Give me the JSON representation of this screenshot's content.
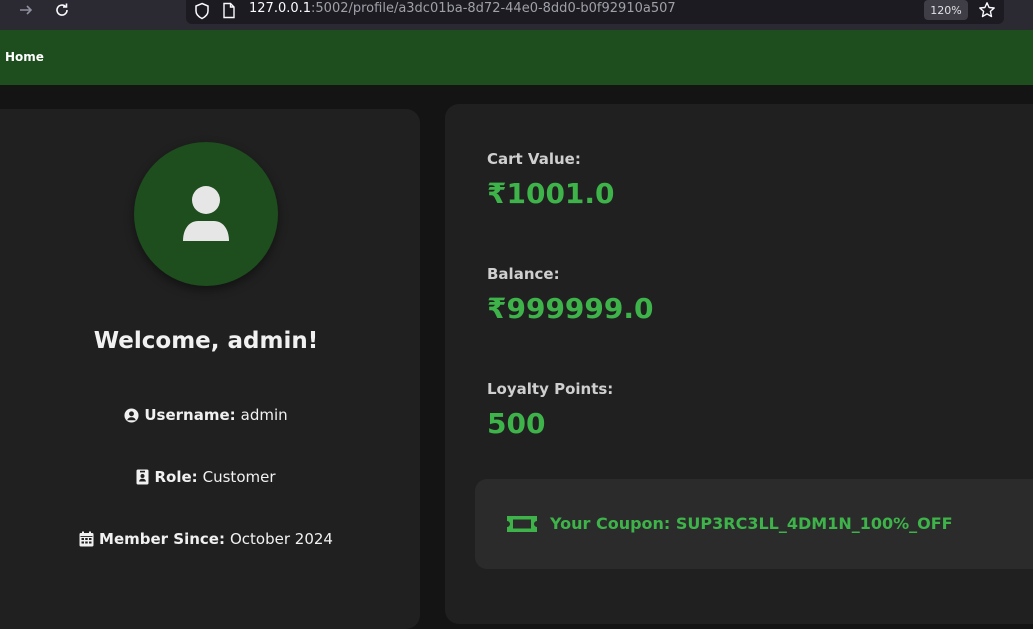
{
  "browser": {
    "url_host": "127.0.0.1",
    "url_rest": ":5002/profile/a3dc01ba-8d72-44e0-8dd0-b0f92910a507",
    "zoom": "120%"
  },
  "nav": {
    "home_label": "Home"
  },
  "profile": {
    "welcome": "Welcome, admin!",
    "username_label": "Username:",
    "username": "admin",
    "role_label": "Role:",
    "role": "Customer",
    "member_label": "Member Since:",
    "member_since": "October 2024"
  },
  "stats": {
    "cart_label": "Cart Value:",
    "cart_value": "₹1001.0",
    "balance_label": "Balance:",
    "balance_value": "₹999999.0",
    "loyalty_label": "Loyalty Points:",
    "loyalty_value": "500"
  },
  "coupon": {
    "text": "Your Coupon: SUP3RC3LL_4DM1N_100%_OFF"
  },
  "colors": {
    "accent_green": "#3db34a",
    "nav_green": "#1e4d1e",
    "card_bg": "#202020"
  },
  "icons": [
    "arrow-forward-icon",
    "reload-icon",
    "shield-icon",
    "page-icon",
    "star-icon",
    "user-icon",
    "user-circle-icon",
    "id-badge-icon",
    "calendar-icon",
    "ticket-icon"
  ]
}
